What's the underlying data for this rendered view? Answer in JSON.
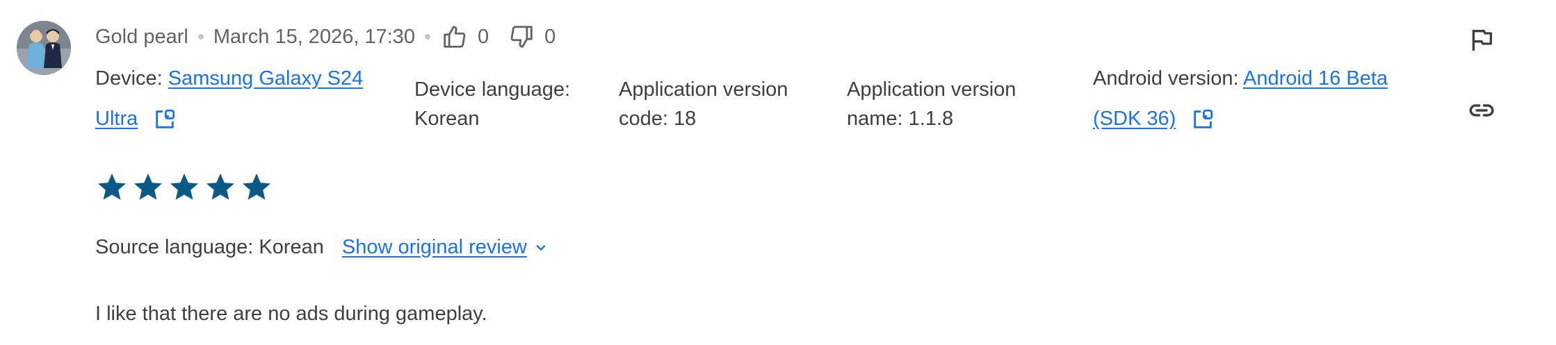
{
  "review": {
    "author": "Gold pearl",
    "timestamp": "March 15, 2026, 17:30",
    "thumbs_up_count": "0",
    "thumbs_down_count": "0",
    "rating": 5,
    "rating_max": 5,
    "text": "I like that there are no ads during gameplay."
  },
  "device": {
    "label": "Device:",
    "name_line1": "Samsung Galaxy S24",
    "name_line2": "Ultra"
  },
  "device_language": {
    "label": "Device language:",
    "value": "Korean"
  },
  "app_version_code": {
    "line1": "Application version",
    "line2": "code: 18"
  },
  "app_version_name": {
    "line1": "Application version",
    "line2": "name: 1.1.8"
  },
  "android_version": {
    "label": "Android version:",
    "link_line1": "Android 16 Beta",
    "link_line2": "(SDK 36)"
  },
  "translation": {
    "source_language": "Source language: Korean",
    "show_original_label": "Show original review"
  },
  "icons": {
    "thumbs_up": "thumbs-up-icon",
    "thumbs_down": "thumbs-down-icon",
    "external": "open-in-new-icon",
    "flag": "flag-icon",
    "link": "link-icon",
    "star": "star-icon",
    "chevron": "chevron-down-icon"
  },
  "colors": {
    "star": "#0b5a86",
    "link": "#1a73e8",
    "text": "#3c4043",
    "muted": "#5f6368"
  }
}
